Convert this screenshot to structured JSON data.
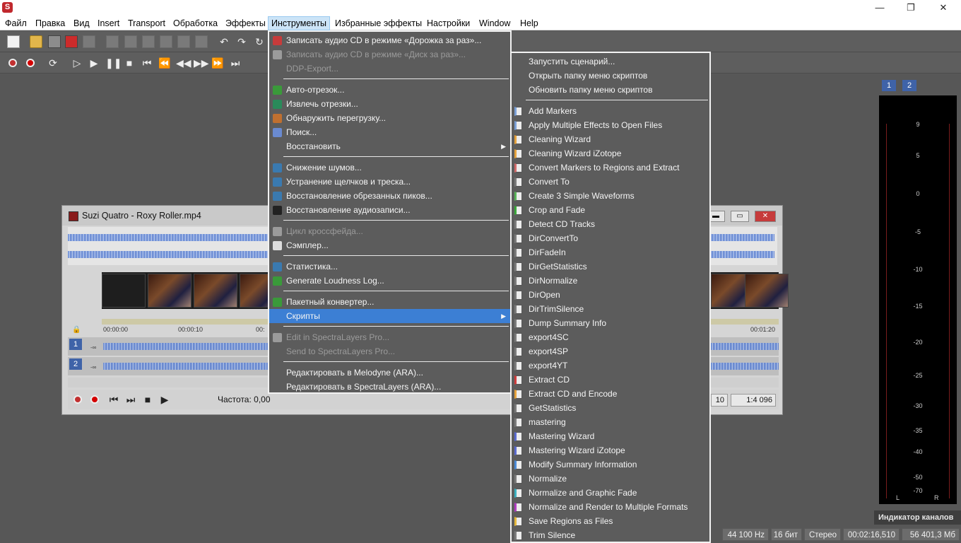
{
  "window": {
    "app_icon": "S",
    "controls": [
      "—",
      "❐",
      "✕"
    ]
  },
  "menubar": [
    "Файл",
    "Правка",
    "Вид",
    "Insert",
    "Transport",
    "Обработка",
    "Эффекты",
    "Инструменты",
    "Избранные эффекты",
    "Настройки",
    "Window",
    "Help"
  ],
  "tools_menu": [
    {
      "label": "Записать аудио CD  в режиме «Дорожка за раз»...",
      "enabled": true,
      "icon": "cd-burn-icon"
    },
    {
      "label": "Записать аудио CD в режиме «Диск за раз»...",
      "enabled": false,
      "icon": "cd-disc-icon"
    },
    {
      "label": "DDP-Export...",
      "enabled": false,
      "icon": ""
    },
    {
      "sep": true
    },
    {
      "label": "Авто-отрезок...",
      "enabled": true,
      "icon": "auto-trim-icon"
    },
    {
      "label": "Извлечь отрезки...",
      "enabled": true,
      "icon": "extract-regions-icon"
    },
    {
      "label": "Обнаружить перегрузку...",
      "enabled": true,
      "icon": "clipping-detect-icon"
    },
    {
      "label": "Поиск...",
      "enabled": true,
      "icon": "search-icon"
    },
    {
      "label": "Восстановить",
      "enabled": true,
      "icon": "",
      "submenu": true
    },
    {
      "sep": true
    },
    {
      "label": "Снижение шумов...",
      "enabled": true,
      "icon": "noise-reduction-icon"
    },
    {
      "label": "Устранение щелчков и треска...",
      "enabled": true,
      "icon": "declick-icon"
    },
    {
      "label": "Восстановление обрезанных пиков...",
      "enabled": true,
      "icon": "declip-icon"
    },
    {
      "label": "Восстановление аудиозаписи...",
      "enabled": true,
      "icon": "restore-icon"
    },
    {
      "sep": true
    },
    {
      "label": "Цикл кроссфейда...",
      "enabled": false,
      "icon": "crossfade-icon"
    },
    {
      "label": "Сэмплер...",
      "enabled": true,
      "icon": "sampler-icon"
    },
    {
      "sep": true
    },
    {
      "label": "Статистика...",
      "enabled": true,
      "icon": "statistics-icon"
    },
    {
      "label": "Generate Loudness Log...",
      "enabled": true,
      "icon": "loudness-log-icon"
    },
    {
      "sep": true
    },
    {
      "label": "Пакетный конвертер...",
      "enabled": true,
      "icon": "batch-converter-icon"
    },
    {
      "label": "Скрипты",
      "enabled": true,
      "icon": "",
      "submenu": true,
      "highlighted": true
    },
    {
      "sep": true
    },
    {
      "label": "Edit in SpectraLayers Pro...",
      "enabled": false,
      "icon": "spectralayers-icon"
    },
    {
      "label": "Send to SpectraLayers Pro...",
      "enabled": false,
      "icon": ""
    },
    {
      "sep": true
    },
    {
      "label": "Редактировать в Melodyne (ARA)...",
      "enabled": true,
      "icon": ""
    },
    {
      "label": "Редактировать в SpectraLayers (ARA)...",
      "enabled": true,
      "icon": ""
    }
  ],
  "scripts_menu": {
    "top": [
      "Запустить сценарий...",
      "Открыть папку меню скриптов",
      "Обновить папку меню скриптов"
    ],
    "items": [
      {
        "label": "Add Markers",
        "color": "#7aa0d8"
      },
      {
        "label": "Apply Multiple Effects to Open Files",
        "color": "#7aa0d8"
      },
      {
        "label": "Cleaning Wizard",
        "color": "#e6a23c"
      },
      {
        "label": "Cleaning Wizard iZotope",
        "color": "#e6a23c"
      },
      {
        "label": "Convert Markers to Regions and Extract",
        "color": "#d26a6a"
      },
      {
        "label": "Convert To",
        "color": "#7a7a7a"
      },
      {
        "label": "Create 3 Simple Waveforms",
        "color": "#5ab55a"
      },
      {
        "label": "Crop and Fade",
        "color": "#3aa83a"
      },
      {
        "label": "Detect CD Tracks",
        "color": "#7a7a7a"
      },
      {
        "label": "DirConvertTo",
        "color": "#7a7a7a"
      },
      {
        "label": "DirFadeIn",
        "color": "#7a7a7a"
      },
      {
        "label": "DirGetStatistics",
        "color": "#7a7a7a"
      },
      {
        "label": "DirNormalize",
        "color": "#7a7a7a"
      },
      {
        "label": "DirOpen",
        "color": "#7a7a7a"
      },
      {
        "label": "DirTrimSilence",
        "color": "#7a7a7a"
      },
      {
        "label": "Dump Summary Info",
        "color": "#7a7a7a"
      },
      {
        "label": "export4SC",
        "color": "#7a7a7a"
      },
      {
        "label": "export4SP",
        "color": "#7a7a7a"
      },
      {
        "label": "export4YT",
        "color": "#7a7a7a"
      },
      {
        "label": "Extract CD",
        "color": "#d03c3c"
      },
      {
        "label": "Extract CD and Encode",
        "color": "#e6a23c"
      },
      {
        "label": "GetStatistics",
        "color": "#7a7a7a"
      },
      {
        "label": "mastering",
        "color": "#7a7a7a"
      },
      {
        "label": "Mastering Wizard",
        "color": "#5a6ad0"
      },
      {
        "label": "Mastering Wizard iZotope",
        "color": "#5a6ad0"
      },
      {
        "label": "Modify Summary Information",
        "color": "#4a8ad8"
      },
      {
        "label": "Normalize",
        "color": "#7a7a7a"
      },
      {
        "label": "Normalize and Graphic Fade",
        "color": "#3ab0c0"
      },
      {
        "label": "Normalize and Render to Multiple Formats",
        "color": "#b03cc0"
      },
      {
        "label": "Save Regions as Files",
        "color": "#e6b83c"
      },
      {
        "label": "Trim Silence",
        "color": "#7a7a7a"
      }
    ]
  },
  "document": {
    "title": "Suzi Quatro - Roxy Roller.mp4",
    "ruler": [
      "00:00:00",
      "00:00:10",
      "00:",
      "00:01:20"
    ],
    "tracks": [
      {
        "num": "1",
        "level": "-∞"
      },
      {
        "num": "2",
        "level": "-∞"
      }
    ],
    "rate_label": "Частота: 0,00",
    "time_box": "10",
    "zoom_box": "1:4 096"
  },
  "meter": {
    "tabs": [
      "1",
      "2"
    ],
    "scale": [
      "9",
      "5",
      "0",
      "-5",
      "-10",
      "-15",
      "-20",
      "-25",
      "-30",
      "-35",
      "-40",
      "-50",
      "-70"
    ],
    "channels": [
      "L",
      "R"
    ],
    "label": "Индикатор каналов"
  },
  "statusbar": {
    "samplerate": "44 100 Hz",
    "bits": "16 бит",
    "channels": "Стерео",
    "duration": "00:02:16,510",
    "size": "56 401,3 Мб"
  }
}
